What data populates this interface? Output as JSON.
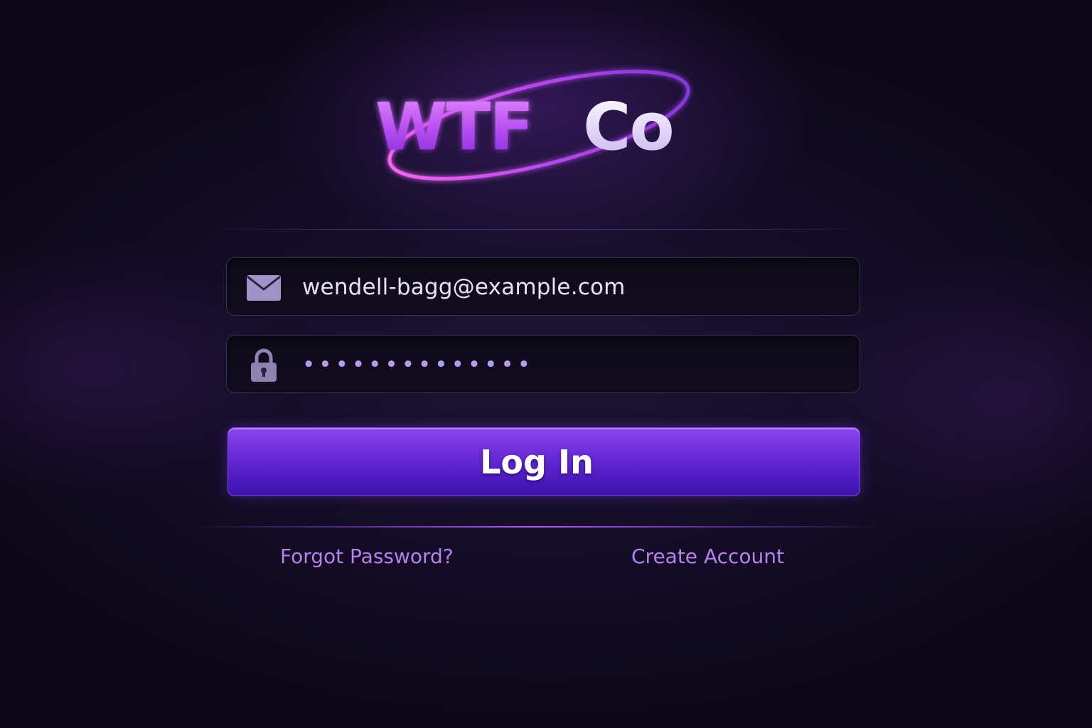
{
  "brand": {
    "name_part1": "WTF",
    "name_part2": "Co"
  },
  "login_form": {
    "email": {
      "icon": "envelope-icon",
      "value": "wendell-bagg@example.com"
    },
    "password": {
      "icon": "lock-icon",
      "masked_value": "••••••••••••••"
    },
    "submit_label": "Log In"
  },
  "links": {
    "forgot_password": "Forgot Password?",
    "create_account": "Create Account"
  },
  "colors": {
    "accent": "#6a2bd8",
    "link": "#b580ee",
    "background": "#140d27"
  }
}
